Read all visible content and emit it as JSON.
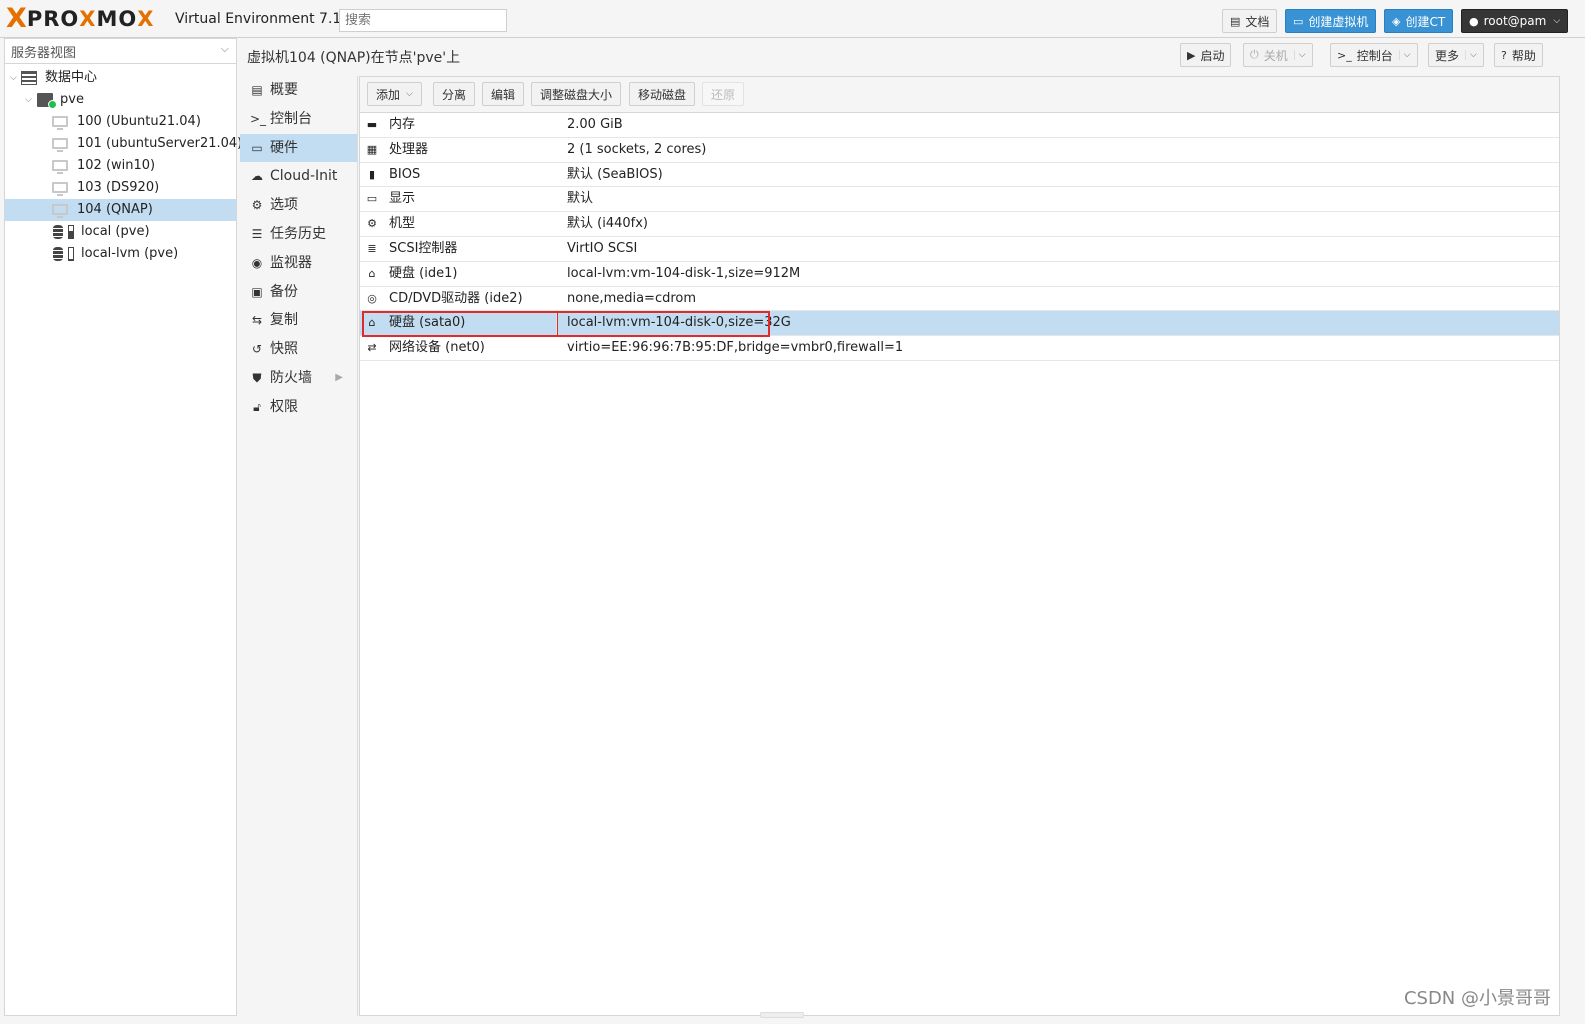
{
  "header": {
    "logo_prefix": "X",
    "logo_text_a": "PRO",
    "logo_text_b": "X",
    "logo_text_c": "MO",
    "logo_text_d": "X",
    "version": "Virtual Environment 7.1-7",
    "search_placeholder": "搜索",
    "docs_label": "文档",
    "create_vm_label": "创建虚拟机",
    "create_ct_label": "创建CT",
    "user_label": "root@pam"
  },
  "tree": {
    "view_selector": "服务器视图",
    "datacenter": "数据中心",
    "node": "pve",
    "items": [
      {
        "label": "100 (Ubuntu21.04)",
        "type": "vm"
      },
      {
        "label": "101 (ubuntuServer21.04)",
        "type": "vm"
      },
      {
        "label": "102 (win10)",
        "type": "vm"
      },
      {
        "label": "103 (DS920)",
        "type": "vm"
      },
      {
        "label": "104 (QNAP)",
        "type": "vm",
        "selected": true
      },
      {
        "label": "local (pve)",
        "type": "storage"
      },
      {
        "label": "local-lvm (pve)",
        "type": "storage"
      }
    ]
  },
  "content": {
    "title": "虚拟机104 (QNAP)在节点'pve'上",
    "actions": {
      "start": "启动",
      "shutdown": "关机",
      "console": "控制台",
      "more": "更多",
      "help": "帮助"
    }
  },
  "nav": {
    "items": [
      {
        "label": "概要",
        "icon": "summary-icon"
      },
      {
        "label": "控制台",
        "icon": "console-icon"
      },
      {
        "label": "硬件",
        "icon": "monitor-icon",
        "selected": true
      },
      {
        "label": "Cloud-Init",
        "icon": "cloud-icon"
      },
      {
        "label": "选项",
        "icon": "gear-icon"
      },
      {
        "label": "任务历史",
        "icon": "list-icon"
      },
      {
        "label": "监视器",
        "icon": "eye-icon"
      },
      {
        "label": "备份",
        "icon": "floppy-icon"
      },
      {
        "label": "复制",
        "icon": "retweet-icon"
      },
      {
        "label": "快照",
        "icon": "history-icon"
      },
      {
        "label": "防火墙",
        "icon": "shield-icon"
      },
      {
        "label": "权限",
        "icon": "unlock-icon"
      }
    ]
  },
  "toolbar": {
    "add": "添加",
    "detach": "分离",
    "edit": "编辑",
    "resize": "调整磁盘大小",
    "move": "移动磁盘",
    "revert": "还原"
  },
  "hardware": {
    "rows": [
      {
        "key": "内存",
        "value": "2.00 GiB",
        "icon": "memory-icon"
      },
      {
        "key": "处理器",
        "value": "2 (1 sockets, 2 cores)",
        "icon": "cpu-icon"
      },
      {
        "key": "BIOS",
        "value": "默认 (SeaBIOS)",
        "icon": "bios-icon"
      },
      {
        "key": "显示",
        "value": "默认",
        "icon": "display-icon"
      },
      {
        "key": "机型",
        "value": "默认 (i440fx)",
        "icon": "cogs-icon"
      },
      {
        "key": "SCSI控制器",
        "value": "VirtIO SCSI",
        "icon": "database-icon"
      },
      {
        "key": "硬盘 (ide1)",
        "value": "local-lvm:vm-104-disk-1,size=912M",
        "icon": "hdd-icon"
      },
      {
        "key": "CD/DVD驱动器 (ide2)",
        "value": "none,media=cdrom",
        "icon": "cdrom-icon"
      },
      {
        "key": "硬盘 (sata0)",
        "value": "local-lvm:vm-104-disk-0,size=32G",
        "icon": "hdd-icon",
        "selected": true
      },
      {
        "key": "网络设备 (net0)",
        "value": "virtio=EE:96:96:7B:95:DF,bridge=vmbr0,firewall=1",
        "icon": "exchange-icon"
      }
    ]
  },
  "watermark": "CSDN @小景哥哥"
}
